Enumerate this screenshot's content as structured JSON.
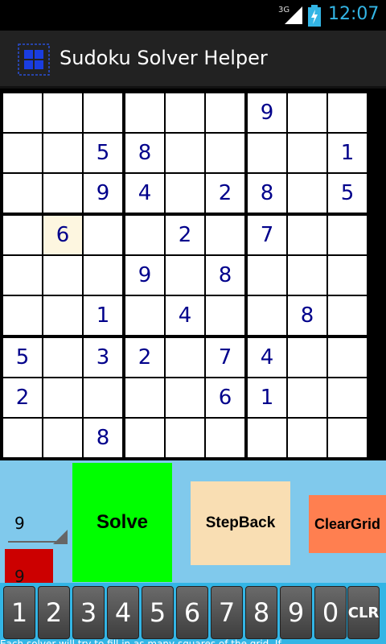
{
  "status": {
    "network": "3G",
    "time": "12:07"
  },
  "app": {
    "title": "Sudoku Solver Helper"
  },
  "grid": [
    [
      "",
      "",
      "",
      "",
      "",
      "",
      "9",
      "",
      ""
    ],
    [
      "",
      "",
      "5",
      "8",
      "",
      "",
      "",
      "",
      "1"
    ],
    [
      "",
      "",
      "9",
      "4",
      "",
      "2",
      "8",
      "",
      "5"
    ],
    [
      "",
      "6",
      "",
      "",
      "2",
      "",
      "7",
      "",
      ""
    ],
    [
      "",
      "",
      "",
      "9",
      "",
      "8",
      "",
      "",
      ""
    ],
    [
      "",
      "",
      "1",
      "",
      "4",
      "",
      "",
      "8",
      ""
    ],
    [
      "5",
      "",
      "3",
      "2",
      "",
      "7",
      "4",
      "",
      ""
    ],
    [
      "2",
      "",
      "",
      "",
      "",
      "6",
      "1",
      "",
      ""
    ],
    [
      "",
      "",
      "8",
      "",
      "",
      "",
      "",
      "",
      ""
    ]
  ],
  "highlight": {
    "row": 3,
    "col": 1
  },
  "controls": {
    "spinner_value": "9",
    "red_box_value": "9",
    "solve_label": "Solve",
    "stepback_label": "StepBack",
    "cleargrid_label": "ClearGrid"
  },
  "keypad": [
    "1",
    "2",
    "3",
    "4",
    "5",
    "6",
    "7",
    "8",
    "9",
    "0",
    "CLR"
  ],
  "ticker": "Each solver will try to fill in as many squares of the grid. If"
}
